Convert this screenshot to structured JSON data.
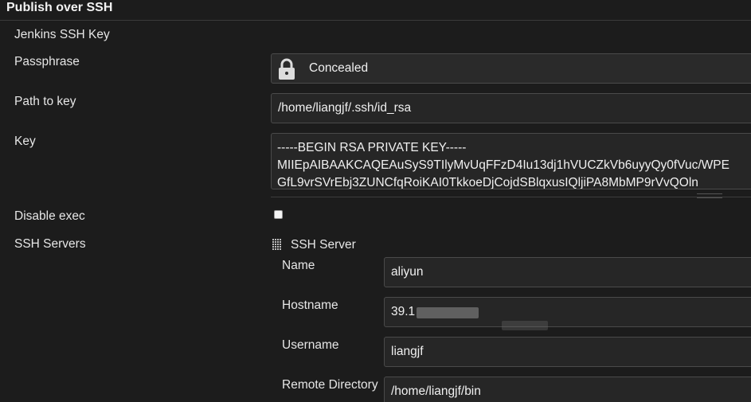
{
  "section": {
    "title": "Publish over SSH"
  },
  "jenkins_ssh_key": {
    "heading": "Jenkins SSH Key"
  },
  "passphrase": {
    "label": "Passphrase",
    "value": "Concealed"
  },
  "path_to_key": {
    "label": "Path to key",
    "value": "/home/liangjf/.ssh/id_rsa"
  },
  "key": {
    "label": "Key",
    "lines": [
      "-----BEGIN RSA PRIVATE KEY-----",
      "MIIEpAIBAAKCAQEAuSyS9TIlyMvUqFFzD4Iu13dj1hVUCZkVb6uyyQy0fVuc/WPE",
      "GfL9vrSVrEbj3ZUNCfqRoiKAI0TkkoeDjCojdSBlqxusIQljiPA8MbMP9rVvQOln"
    ]
  },
  "disable_exec": {
    "label": "Disable exec",
    "checked": false
  },
  "ssh_servers": {
    "label": "SSH Servers",
    "server_title": "SSH Server",
    "name": {
      "label": "Name",
      "value": "aliyun"
    },
    "hostname": {
      "label": "Hostname",
      "value": "39.1"
    },
    "username": {
      "label": "Username",
      "value": "liangjf"
    },
    "remote_directory": {
      "label": "Remote Directory",
      "value": "/home/liangjf/bin"
    }
  },
  "icons": {
    "lock": "lock-icon",
    "drag": "drag-handle-icon"
  },
  "colors": {
    "background": "#1c1c1c",
    "field_background": "#262626",
    "field_border": "#4a4a4a",
    "text": "#e6e6e6"
  }
}
